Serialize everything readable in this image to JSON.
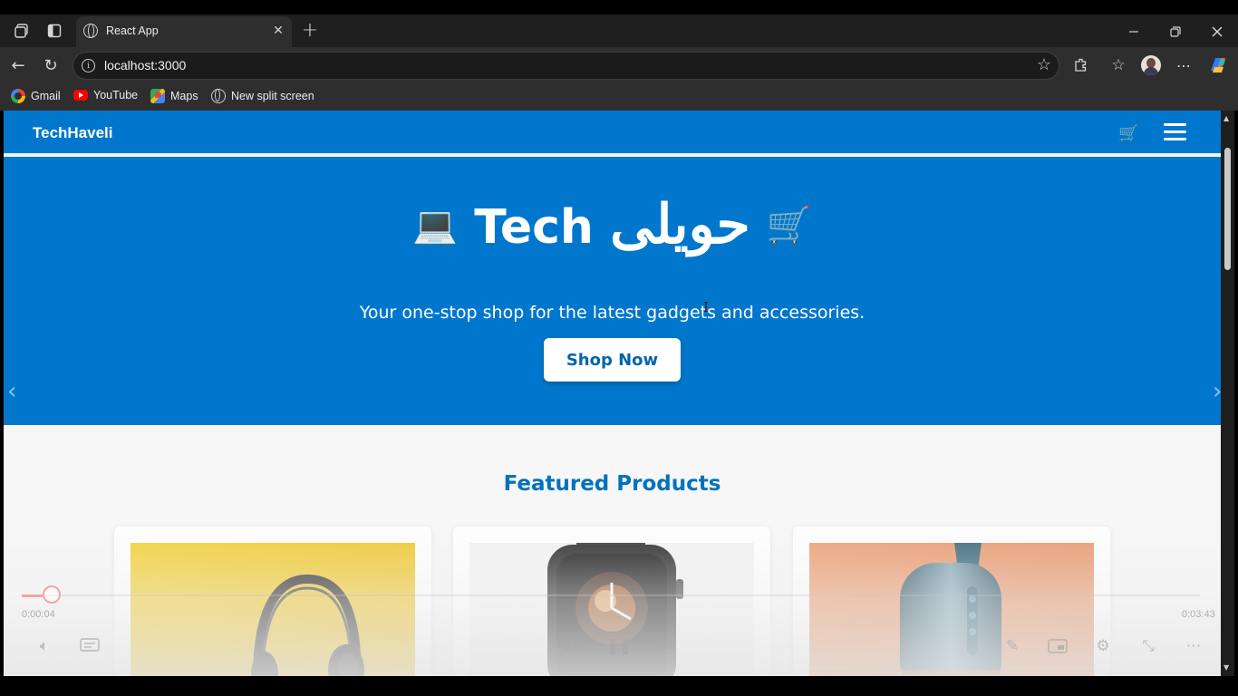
{
  "browser": {
    "tab_title": "React App",
    "url": "localhost:3000",
    "bookmarks": [
      {
        "label": "Gmail",
        "icon": "google-icon"
      },
      {
        "label": "YouTube",
        "icon": "youtube-icon"
      },
      {
        "label": "Maps",
        "icon": "maps-icon"
      },
      {
        "label": "New split screen",
        "icon": "globe-icon"
      }
    ]
  },
  "site": {
    "brand": "TechHaveli",
    "hero": {
      "title_left_emoji": "💻",
      "title_latin": "Tech",
      "title_urdu": "حویلی",
      "title_right_emoji": "🛒",
      "subtitle": "Your one-stop shop for the latest gadgets and accessories.",
      "cta_label": "Shop Now",
      "prev_arrow": "‹",
      "next_arrow": "›"
    },
    "featured_title": "Featured Products",
    "products": [
      {
        "name": "headphones",
        "bg": "#f0c419"
      },
      {
        "name": "smartwatch",
        "bg": "#f3f3f3"
      },
      {
        "name": "bluetooth-speaker",
        "bg": "#e8956a"
      }
    ]
  },
  "video": {
    "elapsed": "0:00:04",
    "duration": "0:03:43",
    "progress_fraction": 0.018
  },
  "colors": {
    "brand_blue": "#0077cc",
    "heading_blue": "#0072bf",
    "chrome_dark": "#2e2e2e"
  }
}
